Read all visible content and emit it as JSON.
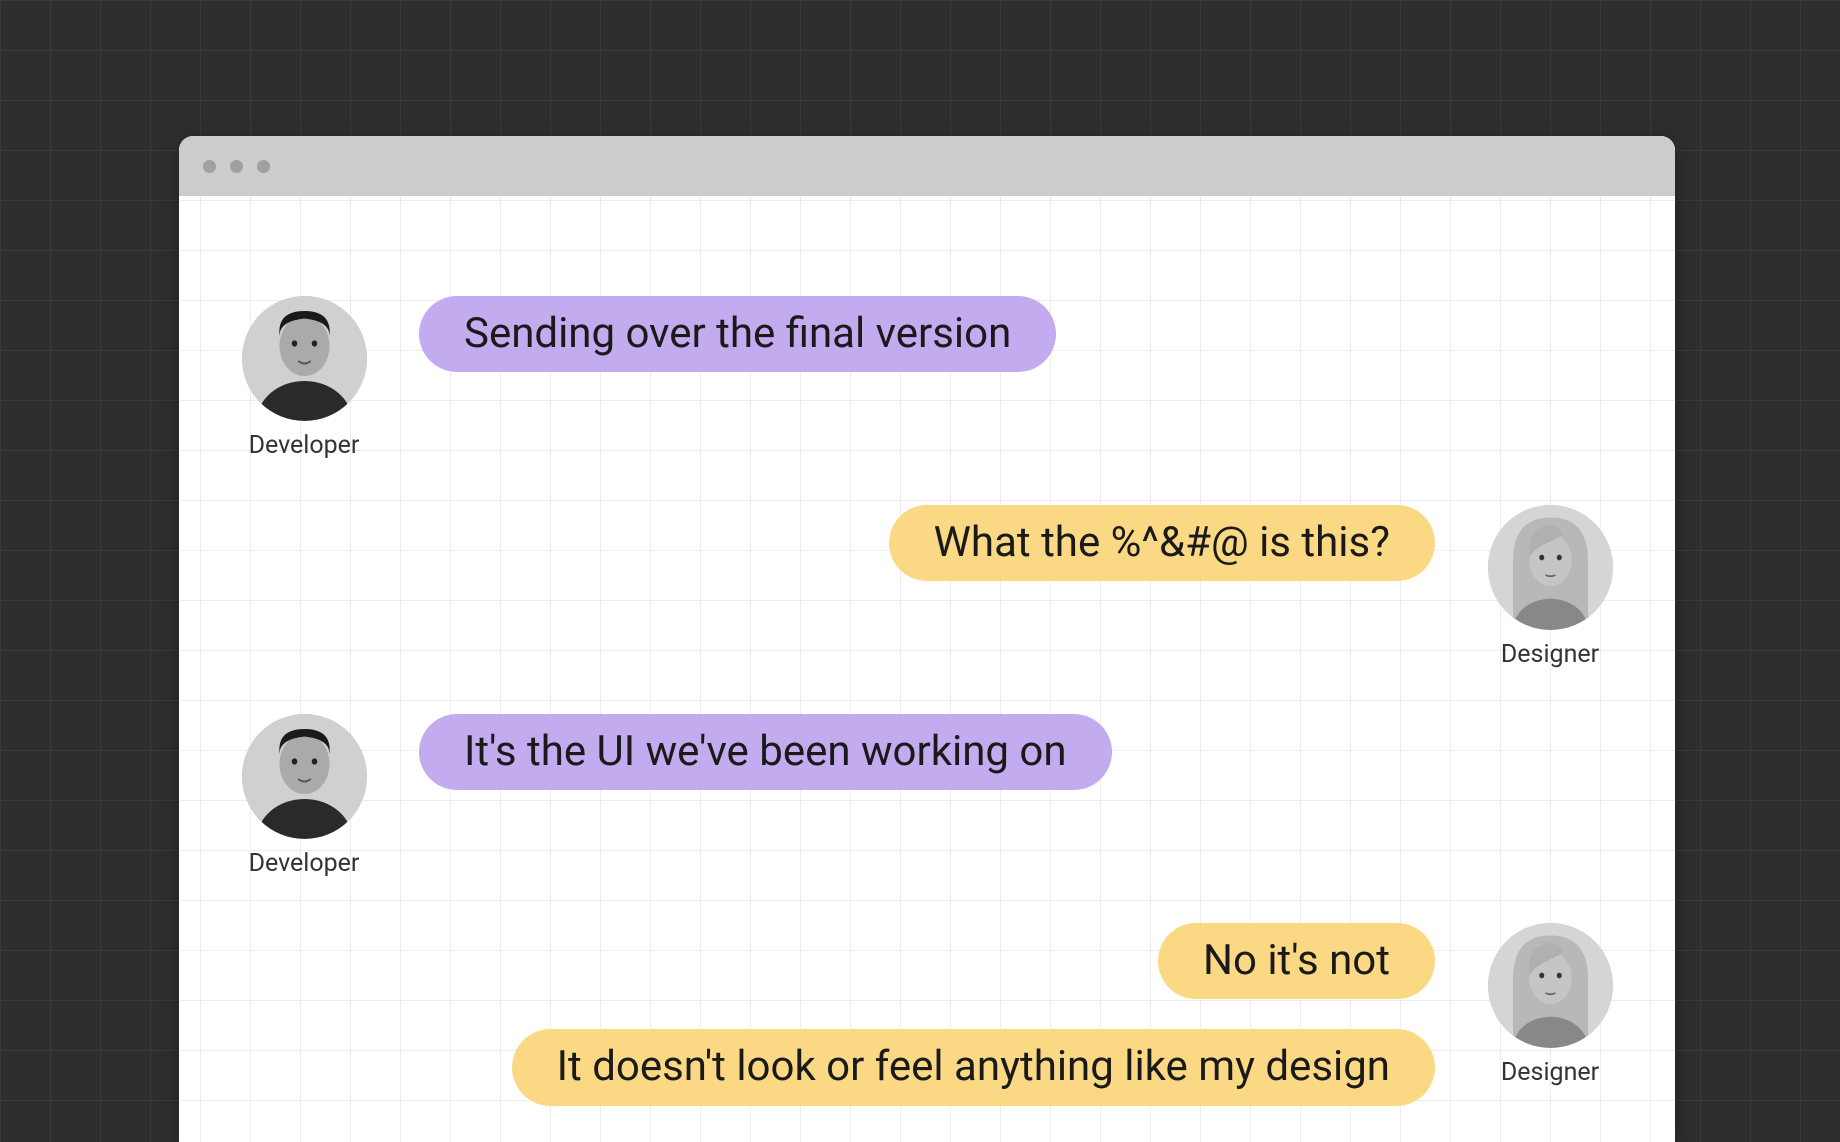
{
  "roles": {
    "developer": "Developer",
    "designer": "Designer"
  },
  "colors": {
    "developer_bubble": "#c2abef",
    "designer_bubble": "#fbd984",
    "background": "#2e2e2e",
    "titlebar": "#cccccc"
  },
  "messages": {
    "m1": "Sending over the final version",
    "m2": "What the %^&#@ is this?",
    "m3": "It's the UI we've been working on",
    "m4": "No it's not",
    "m5": "It doesn't look or feel anything like my design"
  }
}
